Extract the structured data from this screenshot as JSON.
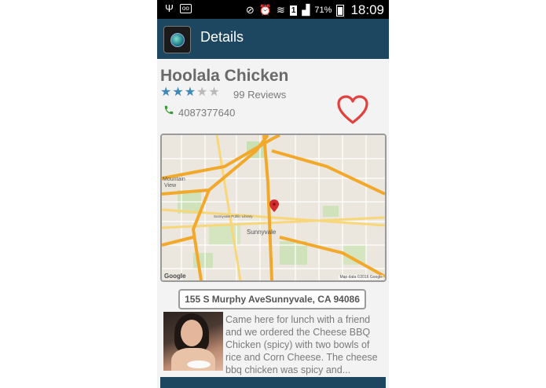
{
  "status_bar": {
    "battery": "71%",
    "time": "18:09",
    "icons": [
      "usb-icon",
      "voicemail-icon",
      "mute-icon",
      "alarm-icon",
      "wifi-icon",
      "sim-icon",
      "signal-icon",
      "battery-icon"
    ]
  },
  "action_bar": {
    "title": "Details",
    "background": "#1d4760"
  },
  "business": {
    "name": "Hoolala Chicken",
    "rating": 3,
    "max_rating": 5,
    "reviews": "99 Reviews",
    "phone": "4087377640",
    "address": "155 S Murphy AveSunnyvale, CA 94086",
    "favorite_color": "#e2413f"
  },
  "map": {
    "labels": {
      "mountain_view_1": "Mountain",
      "mountain_view_2": "View",
      "sunnyvale": "Sunnyvale",
      "library": "Sunnyvale Public Library"
    },
    "attribution": "Map data ©2016 Google",
    "google": "Google"
  },
  "review": {
    "text": "Came here for lunch with a friend and we ordered the Cheese BBQ Chicken (spicy) with two bowls of rice and Corn Cheese. The cheese bbq chicken was spicy and..."
  }
}
